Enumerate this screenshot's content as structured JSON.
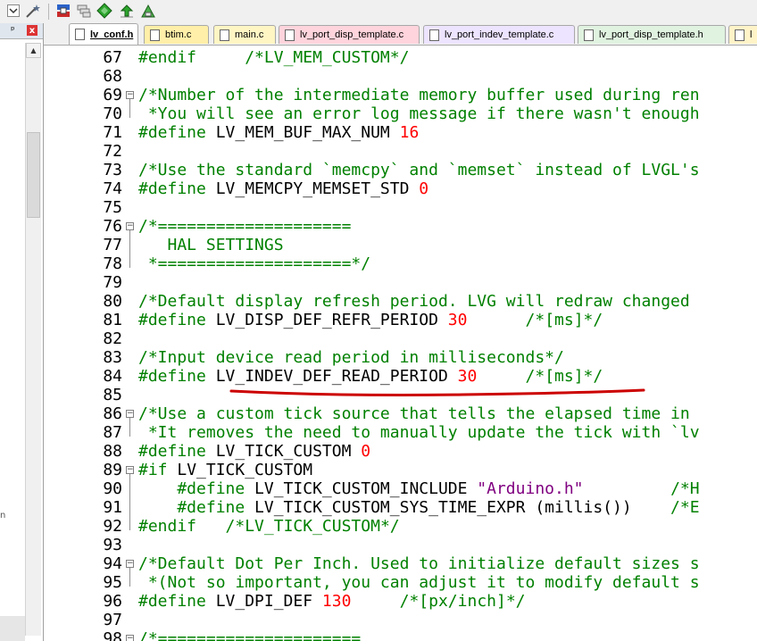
{
  "toolbar": {
    "icons": [
      "dropdown-arrow-icon",
      "wand-icon",
      "translate-icon",
      "stack-icon",
      "diamond-icon",
      "download-icon",
      "build-icon"
    ]
  },
  "left_panel": {
    "pin_glyph": "ᵖ",
    "close_glyph": "x",
    "partial_char": "n"
  },
  "tabs": [
    {
      "label": "lv_conf.h",
      "active": true,
      "color": "#ffffff"
    },
    {
      "label": "btim.c",
      "active": false,
      "color": "#ffefa8"
    },
    {
      "label": "main.c",
      "active": false,
      "color": "#fff6c4"
    },
    {
      "label": "lv_port_disp_template.c",
      "active": false,
      "color": "#ffd4dc"
    },
    {
      "label": "lv_port_indev_template.c",
      "active": false,
      "color": "#ede4ff"
    },
    {
      "label": "lv_port_disp_template.h",
      "active": false,
      "color": "#e0f2e0"
    },
    {
      "label": "l",
      "active": false,
      "color": "#fff3c8"
    }
  ],
  "colors": {
    "comment": "#008000",
    "number": "#ff0000",
    "string": "#800080",
    "annotation": "#cc0000"
  },
  "lines": [
    {
      "n": "67",
      "fold": "",
      "segs": [
        [
          "pp",
          "#endif"
        ],
        [
          "",
          "     "
        ],
        [
          "cm",
          "/*LV_MEM_CUSTOM*/"
        ]
      ]
    },
    {
      "n": "68",
      "fold": "",
      "segs": []
    },
    {
      "n": "69",
      "fold": "minus",
      "segs": [
        [
          "cm",
          "/*Number of the intermediate memory buffer used during ren"
        ]
      ]
    },
    {
      "n": "70",
      "fold": "",
      "segs": [
        [
          "cm",
          " *You will see an error log message if there wasn't enough"
        ]
      ]
    },
    {
      "n": "71",
      "fold": "",
      "segs": [
        [
          "pp",
          "#define "
        ],
        [
          "",
          "LV_MEM_BUF_MAX_NUM "
        ],
        [
          "nm",
          "16"
        ]
      ]
    },
    {
      "n": "72",
      "fold": "",
      "segs": []
    },
    {
      "n": "73",
      "fold": "",
      "segs": [
        [
          "cm",
          "/*Use the standard `memcpy` and `memset` instead of LVGL's"
        ]
      ]
    },
    {
      "n": "74",
      "fold": "",
      "segs": [
        [
          "pp",
          "#define "
        ],
        [
          "",
          "LV_MEMCPY_MEMSET_STD "
        ],
        [
          "nm",
          "0"
        ]
      ]
    },
    {
      "n": "75",
      "fold": "",
      "segs": []
    },
    {
      "n": "76",
      "fold": "minus",
      "segs": [
        [
          "cm",
          "/*===================="
        ]
      ]
    },
    {
      "n": "77",
      "fold": "",
      "segs": [
        [
          "cm",
          "   HAL SETTINGS"
        ]
      ]
    },
    {
      "n": "78",
      "fold": "",
      "segs": [
        [
          "cm",
          " *====================*/"
        ]
      ]
    },
    {
      "n": "79",
      "fold": "",
      "segs": []
    },
    {
      "n": "80",
      "fold": "",
      "segs": [
        [
          "cm",
          "/*Default display refresh period. LVG will redraw changed"
        ]
      ]
    },
    {
      "n": "81",
      "fold": "",
      "segs": [
        [
          "pp",
          "#define "
        ],
        [
          "",
          "LV_DISP_DEF_REFR_PERIOD "
        ],
        [
          "nm",
          "30"
        ],
        [
          "",
          "      "
        ],
        [
          "cm",
          "/*[ms]*/"
        ]
      ]
    },
    {
      "n": "82",
      "fold": "",
      "segs": []
    },
    {
      "n": "83",
      "fold": "",
      "segs": [
        [
          "cm",
          "/*Input device read period in milliseconds*/"
        ]
      ]
    },
    {
      "n": "84",
      "fold": "",
      "segs": [
        [
          "pp",
          "#define "
        ],
        [
          "",
          "LV_INDEV_DEF_READ_PERIOD "
        ],
        [
          "nm",
          "30"
        ],
        [
          "",
          "     "
        ],
        [
          "cm",
          "/*[ms]*/"
        ]
      ]
    },
    {
      "n": "85",
      "fold": "",
      "segs": []
    },
    {
      "n": "86",
      "fold": "minus",
      "segs": [
        [
          "cm",
          "/*Use a custom tick source that tells the elapsed time in"
        ]
      ]
    },
    {
      "n": "87",
      "fold": "",
      "segs": [
        [
          "cm",
          " *It removes the need to manually update the tick with `lv"
        ]
      ]
    },
    {
      "n": "88",
      "fold": "",
      "segs": [
        [
          "pp",
          "#define "
        ],
        [
          "",
          "LV_TICK_CUSTOM "
        ],
        [
          "nm",
          "0"
        ]
      ]
    },
    {
      "n": "89",
      "fold": "minus",
      "segs": [
        [
          "pp",
          "#if "
        ],
        [
          "",
          "LV_TICK_CUSTOM"
        ]
      ]
    },
    {
      "n": "90",
      "fold": "",
      "segs": [
        [
          "pp",
          "    #define "
        ],
        [
          "",
          "LV_TICK_CUSTOM_INCLUDE "
        ],
        [
          "st",
          "\"Arduino.h\""
        ],
        [
          "",
          "         "
        ],
        [
          "cm",
          "/*H"
        ]
      ]
    },
    {
      "n": "91",
      "fold": "",
      "segs": [
        [
          "pp",
          "    #define "
        ],
        [
          "",
          "LV_TICK_CUSTOM_SYS_TIME_EXPR (millis())    "
        ],
        [
          "cm",
          "/*E"
        ]
      ]
    },
    {
      "n": "92",
      "fold": "",
      "segs": [
        [
          "pp",
          "#endif"
        ],
        [
          "",
          "   "
        ],
        [
          "cm",
          "/*LV_TICK_CUSTOM*/"
        ]
      ]
    },
    {
      "n": "93",
      "fold": "",
      "segs": []
    },
    {
      "n": "94",
      "fold": "minus",
      "segs": [
        [
          "cm",
          "/*Default Dot Per Inch. Used to initialize default sizes s"
        ]
      ]
    },
    {
      "n": "95",
      "fold": "",
      "segs": [
        [
          "cm",
          " *(Not so important, you can adjust it to modify default s"
        ]
      ]
    },
    {
      "n": "96",
      "fold": "",
      "segs": [
        [
          "pp",
          "#define "
        ],
        [
          "",
          "LV_DPI_DEF "
        ],
        [
          "nm",
          "130"
        ],
        [
          "",
          "     "
        ],
        [
          "cm",
          "/*[px/inch]*/"
        ]
      ]
    },
    {
      "n": "97",
      "fold": "",
      "segs": []
    },
    {
      "n": "98",
      "fold": "minus",
      "segs": [
        [
          "cm",
          "/*====================="
        ]
      ]
    }
  ]
}
